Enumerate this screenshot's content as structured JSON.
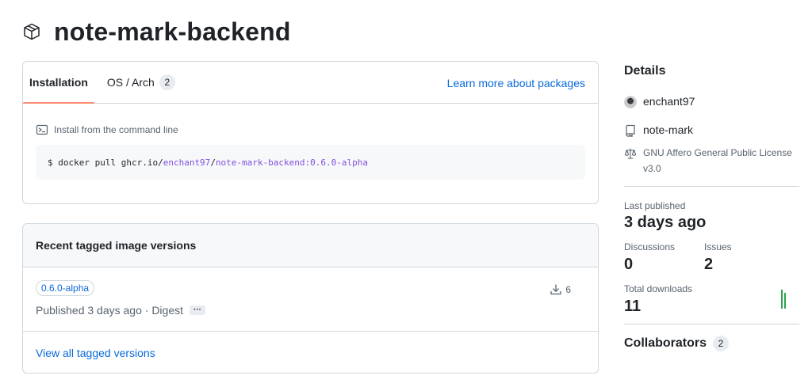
{
  "header": {
    "title": "note-mark-backend",
    "icon": "package-icon"
  },
  "install": {
    "tabs": [
      {
        "label": "Installation",
        "selected": true
      },
      {
        "label": "OS / Arch",
        "count": "2",
        "selected": false
      }
    ],
    "learn_more": "Learn more about packages",
    "cmd_label": "Install from the command line",
    "command_prefix": "$ docker pull ghcr.io/",
    "command_owner": "enchant97",
    "command_sep": "/",
    "command_image": "note-mark-backend:0.6.0-alpha"
  },
  "versions": {
    "heading": "Recent tagged image versions",
    "items": [
      {
        "tag": "0.6.0-alpha",
        "published": "Published 3 days ago · Digest",
        "menu": "···",
        "downloads": "6"
      }
    ],
    "view_all": "View all tagged versions"
  },
  "sidebar": {
    "details_heading": "Details",
    "owner": "enchant97",
    "repo": "note-mark",
    "license_line1": "GNU Affero General Public License",
    "license_line2": "v3.0",
    "last_published_label": "Last published",
    "last_published_value": "3 days ago",
    "discussions_label": "Discussions",
    "discussions_value": "0",
    "issues_label": "Issues",
    "issues_value": "2",
    "downloads_label": "Total downloads",
    "downloads_value": "11",
    "collaborators_label": "Collaborators",
    "collaborators_count": "2"
  },
  "colors": {
    "link": "#0969da",
    "tab_underline": "#fd8c73",
    "code_accent": "#8250df",
    "sparkline": "#2da44e",
    "border": "#d0d7de"
  }
}
